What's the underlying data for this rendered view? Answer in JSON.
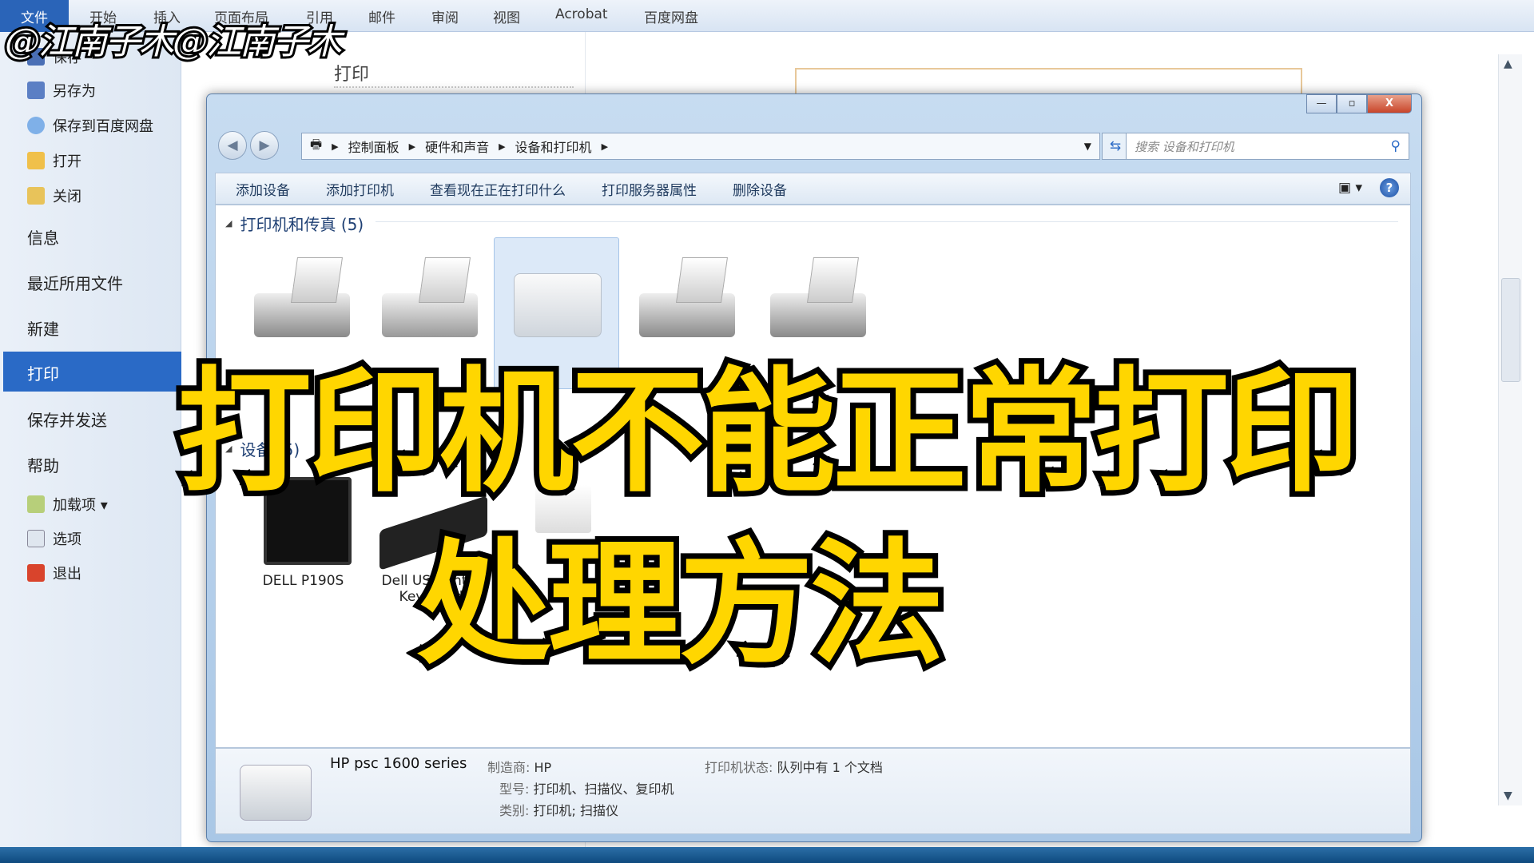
{
  "watermark": "@江南子木@江南子木",
  "ribbon": {
    "tabs": [
      "文件",
      "开始",
      "插入",
      "页面布局",
      "引用",
      "邮件",
      "审阅",
      "视图",
      "Acrobat",
      "百度网盘"
    ]
  },
  "sidebar": {
    "items": [
      {
        "label": "保存",
        "icon": "save-icon"
      },
      {
        "label": "另存为",
        "icon": "save-as-icon"
      },
      {
        "label": "保存到百度网盘",
        "icon": "cloud-icon"
      },
      {
        "label": "打开",
        "icon": "folder-open-icon"
      },
      {
        "label": "关闭",
        "icon": "folder-close-icon"
      },
      {
        "label": "信息"
      },
      {
        "label": "最近所用文件"
      },
      {
        "label": "新建"
      },
      {
        "label": "打印",
        "selected": true
      },
      {
        "label": "保存并发送"
      },
      {
        "label": "帮助"
      },
      {
        "label": "加载项 ▾",
        "icon": "addin-icon"
      },
      {
        "label": "选项",
        "icon": "options-icon"
      },
      {
        "label": "退出",
        "icon": "exit-icon"
      }
    ],
    "accent": "#2a6ac6"
  },
  "backstage": {
    "title": "打印"
  },
  "explorer": {
    "breadcrumb": [
      "控制面板",
      "硬件和声音",
      "设备和打印机"
    ],
    "search_placeholder": "搜索 设备和打印机",
    "toolbar": [
      "添加设备",
      "添加打印机",
      "查看现在正在打印什么",
      "打印服务器属性",
      "删除设备"
    ],
    "printers_group": "打印机和传真 (5)",
    "devices_group": "设备 (5)",
    "devices": [
      {
        "label": "DELL P190S",
        "icon": "monitor-icon"
      },
      {
        "label": "Dell USB Entry Keyboard",
        "icon": "keyboard-icon"
      }
    ],
    "details": {
      "name": "HP psc 1600 series",
      "manufacturer_label": "制造商:",
      "manufacturer": "HP",
      "model_label": "型号:",
      "model": "打印机、扫描仪、复印机",
      "category_label": "类别:",
      "category": "打印机; 扫描仪",
      "status_label": "打印机状态:",
      "status": "队列中有 1 个文档"
    }
  },
  "overlay": {
    "line1": "打印机不能正常打印",
    "line2": "处理方法",
    "color": "#ffd600"
  }
}
